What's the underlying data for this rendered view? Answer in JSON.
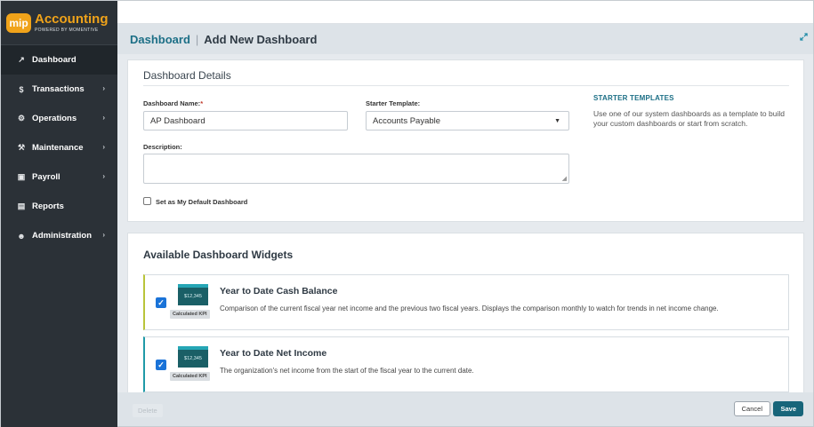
{
  "app": {
    "logo_badge": "mip",
    "logo_title": "Accounting",
    "logo_subtitle": "POWERED BY MOMENTIVE"
  },
  "sidebar": {
    "items": [
      {
        "label": "Dashboard",
        "icon": "chart-line-icon",
        "glyph": "↗",
        "active": true,
        "has_children": false
      },
      {
        "label": "Transactions",
        "icon": "dollar-icon",
        "glyph": "$",
        "active": false,
        "has_children": true
      },
      {
        "label": "Operations",
        "icon": "cogs-icon",
        "glyph": "⚙",
        "active": false,
        "has_children": true
      },
      {
        "label": "Maintenance",
        "icon": "wrench-icon",
        "glyph": "⚒",
        "active": false,
        "has_children": true
      },
      {
        "label": "Payroll",
        "icon": "money-icon",
        "glyph": "▣",
        "active": false,
        "has_children": true
      },
      {
        "label": "Reports",
        "icon": "file-icon",
        "glyph": "▤",
        "active": false,
        "has_children": false
      },
      {
        "label": "Administration",
        "icon": "users-icon",
        "glyph": "☻",
        "active": false,
        "has_children": true
      }
    ],
    "chevron": "›"
  },
  "header": {
    "breadcrumb_link": "Dashboard",
    "breadcrumb_sep": "|",
    "breadcrumb_current": "Add New Dashboard",
    "expand_icon": "expand-icon"
  },
  "details": {
    "title": "Dashboard Details",
    "name_label": "Dashboard Name:",
    "name_required": "*",
    "name_value": "AP Dashboard",
    "template_label": "Starter Template:",
    "template_value": "Accounts Payable",
    "description_label": "Description:",
    "description_value": "",
    "default_label": "Set as My Default Dashboard",
    "default_checked": false,
    "side_heading": "STARTER TEMPLATES",
    "side_text": "Use one of our system dashboards as a template to build your custom dashboards or start from scratch."
  },
  "widgets": {
    "title": "Available Dashboard Widgets",
    "items": [
      {
        "title": "Year to Date Cash Balance",
        "description": "Comparison of the current fiscal year net income and the previous two fiscal years. Displays the comparison monthly to watch for trends in net income change.",
        "thumb_value": "$12,345",
        "tag": "Calculated KPI",
        "checked": true,
        "accent": "#b9c43a"
      },
      {
        "title": "Year to Date Net Income",
        "description": "The organization's net income from the start of the fiscal year to the current date.",
        "thumb_value": "$12,345",
        "tag": "Calculated KPI",
        "checked": true,
        "accent": "#1f9aa8"
      }
    ]
  },
  "footer": {
    "delete_label": "Delete",
    "cancel_label": "Cancel",
    "save_label": "Save"
  },
  "colors": {
    "brand_orange": "#f0a31a",
    "link_teal": "#1c6f86",
    "save_button": "#17657a",
    "checkbox_blue": "#1a73d8"
  }
}
